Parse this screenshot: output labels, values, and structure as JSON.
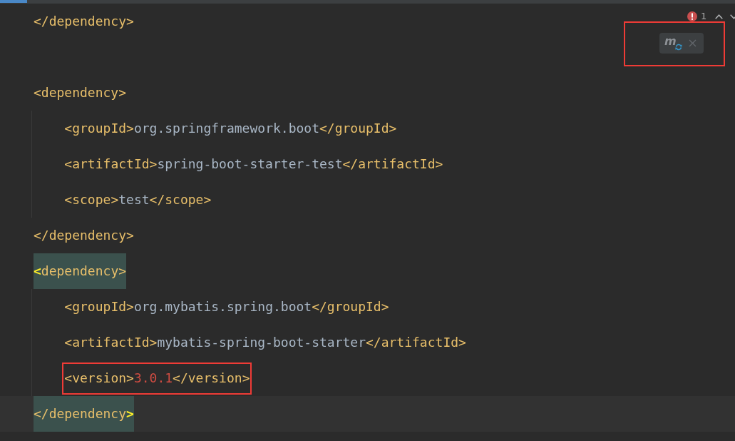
{
  "editor": {
    "lines": [
      {
        "kind": "code",
        "current": false,
        "match_highlight": false,
        "annotated": false,
        "tokens": [
          {
            "kind": "tag",
            "text": "</dependency>"
          }
        ]
      },
      {
        "kind": "blank"
      },
      {
        "kind": "code",
        "current": false,
        "match_highlight": false,
        "annotated": false,
        "tokens": [
          {
            "kind": "tag",
            "text": "<dependency>"
          }
        ],
        "children": [
          {
            "kind": "code",
            "current": false,
            "match_highlight": false,
            "annotated": false,
            "tokens": [
              {
                "kind": "tag",
                "text": "<groupId>"
              },
              {
                "kind": "text",
                "text": "org.springframework.boot"
              },
              {
                "kind": "tag",
                "text": "</groupId>"
              }
            ]
          },
          {
            "kind": "code",
            "current": false,
            "match_highlight": false,
            "annotated": false,
            "tokens": [
              {
                "kind": "tag",
                "text": "<artifactId>"
              },
              {
                "kind": "text",
                "text": "spring-boot-starter-test"
              },
              {
                "kind": "tag",
                "text": "</artifactId>"
              }
            ]
          },
          {
            "kind": "code",
            "current": false,
            "match_highlight": false,
            "annotated": false,
            "tokens": [
              {
                "kind": "tag",
                "text": "<scope>"
              },
              {
                "kind": "text",
                "text": "test"
              },
              {
                "kind": "tag",
                "text": "</scope>"
              }
            ]
          }
        ]
      },
      {
        "kind": "code",
        "current": false,
        "match_highlight": false,
        "annotated": false,
        "tokens": [
          {
            "kind": "tag",
            "text": "</dependency>"
          }
        ]
      },
      {
        "kind": "code",
        "current": false,
        "match_highlight": true,
        "annotated": false,
        "tokens": [
          {
            "kind": "bracket",
            "text": "<"
          },
          {
            "kind": "tag",
            "text": "dependency>"
          }
        ],
        "children": [
          {
            "kind": "code",
            "current": false,
            "match_highlight": false,
            "annotated": false,
            "tokens": [
              {
                "kind": "tag",
                "text": "<groupId>"
              },
              {
                "kind": "text",
                "text": "org.mybatis.spring.boot"
              },
              {
                "kind": "tag",
                "text": "</groupId>"
              }
            ]
          },
          {
            "kind": "code",
            "current": false,
            "match_highlight": false,
            "annotated": false,
            "tokens": [
              {
                "kind": "tag",
                "text": "<artifactId>"
              },
              {
                "kind": "text",
                "text": "mybatis-spring-boot-starter"
              },
              {
                "kind": "tag",
                "text": "</artifactId>"
              }
            ]
          },
          {
            "kind": "code",
            "current": false,
            "match_highlight": false,
            "annotated": true,
            "tokens": [
              {
                "kind": "tag",
                "text": "<version>"
              },
              {
                "kind": "invalid",
                "text": "3.0.1"
              },
              {
                "kind": "tag",
                "text": "</version>"
              }
            ]
          }
        ]
      },
      {
        "kind": "code",
        "current": true,
        "match_highlight": true,
        "annotated": false,
        "tokens": [
          {
            "kind": "tag",
            "text": "</dependency"
          },
          {
            "kind": "bracket",
            "text": ">"
          }
        ]
      }
    ]
  },
  "inspections": {
    "error_count": "1"
  },
  "notification": {
    "icon_letter": "m",
    "annotated": true
  }
}
